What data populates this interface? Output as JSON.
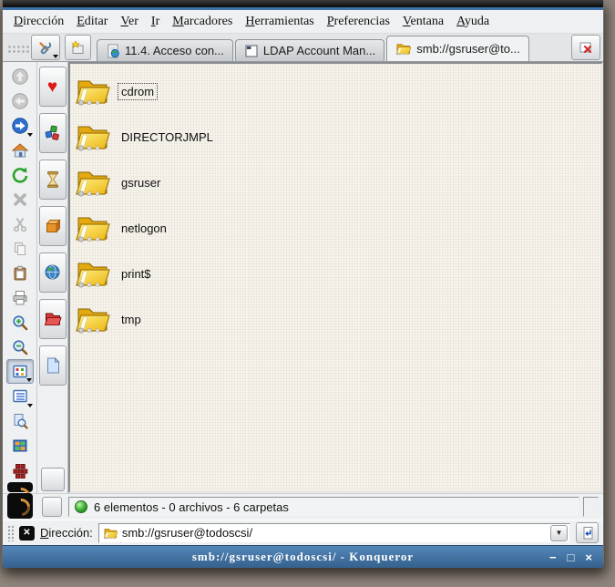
{
  "window": {
    "title": "smb://gsruser@todoscsi/ - Konqueror",
    "controls": {
      "minimize": "−",
      "maximize": "□",
      "close": "×"
    }
  },
  "menubar": {
    "items": [
      "Dirección",
      "Editar",
      "Ver",
      "Ir",
      "Marcadores",
      "Herramientas",
      "Preferencias",
      "Ventana",
      "Ayuda"
    ]
  },
  "tabbar": {
    "tabs": [
      {
        "label": "11.4. Acceso con...",
        "icon": "html-page-icon",
        "active": false
      },
      {
        "label": "LDAP Account Man...",
        "icon": "app-window-icon",
        "active": false
      },
      {
        "label": "smb://gsruser@to...",
        "icon": "open-folder-icon",
        "active": true
      }
    ]
  },
  "toolbars": {
    "main": [
      "up (disabled)",
      "back (disabled)",
      "forward",
      "home",
      "reload",
      "stop (disabled)",
      "cut (disabled)",
      "copy (disabled)",
      "paste",
      "print",
      "zoom-in",
      "zoom-out",
      "icon-view (pressed)",
      "list-view",
      "preview",
      "multicolumn-view",
      "detach-bricks"
    ],
    "extra": [
      "tools-wrench",
      "bookmarks-heart",
      "components",
      "hourglass",
      "package",
      "globe",
      "red-folder",
      "note"
    ]
  },
  "folders": {
    "items": [
      "cdrom",
      "DIRECTORJMPL",
      "gsruser",
      "netlogon",
      "print$",
      "tmp"
    ],
    "selected": "cdrom"
  },
  "statusbar": {
    "text": "6 elementos - 0 archivos - 6 carpetas"
  },
  "locationbar": {
    "label": "Dirección:",
    "value": "smb://gsruser@todoscsi/"
  },
  "icons": {
    "clear_location": "✕",
    "dropdown": "▼",
    "heart": "♥"
  },
  "colors": {
    "titlebar_blue": "#3a6ea5",
    "frame_accent": "#3e72aa",
    "chrome_gray": "#eff0f1",
    "view_background": "#f7f4ec",
    "folder_yellow": "#e9b210",
    "status_led_green": "#2fa32a"
  }
}
